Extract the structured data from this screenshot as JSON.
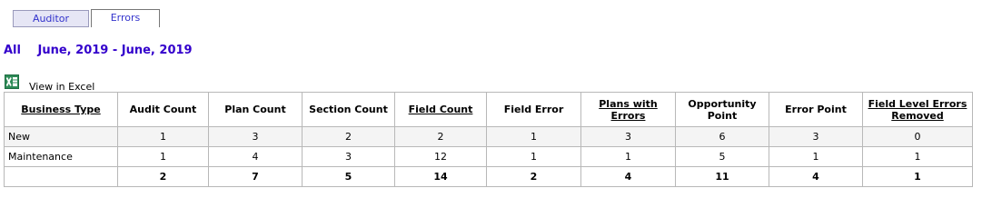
{
  "tabs": [
    {
      "label": "Auditor"
    },
    {
      "label": "Errors"
    }
  ],
  "period": {
    "scope": "All",
    "range": "June, 2019 - June, 2019"
  },
  "excel": {
    "label": "View in Excel",
    "icon": "excel-icon"
  },
  "table": {
    "headers": [
      "Business Type",
      "Audit Count",
      "Plan Count",
      "Section Count",
      "Field Count",
      "Field Error",
      "Plans with Errors",
      "Opportunity Point",
      "Error Point",
      "Field Level Errors Removed"
    ],
    "rows": [
      {
        "cells": [
          "New",
          "1",
          "3",
          "2",
          "2",
          "1",
          "3",
          "6",
          "3",
          "0"
        ]
      },
      {
        "cells": [
          "Maintenance",
          "1",
          "4",
          "3",
          "12",
          "1",
          "1",
          "5",
          "1",
          "1"
        ]
      }
    ],
    "totals": [
      "",
      "2",
      "7",
      "5",
      "14",
      "2",
      "4",
      "11",
      "4",
      "1"
    ]
  },
  "colors": {
    "tab_text": "#3333cc",
    "period_text": "#3300cc",
    "excel_green": "#1d6f42"
  }
}
